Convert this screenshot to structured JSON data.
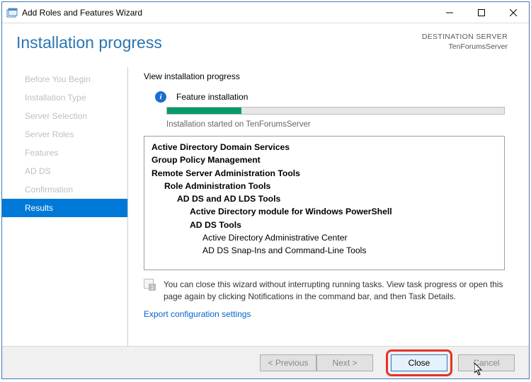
{
  "window": {
    "title": "Add Roles and Features Wizard"
  },
  "header": {
    "page_title": "Installation progress",
    "destination_label": "DESTINATION SERVER",
    "destination_value": "TenForumsServer"
  },
  "sidebar": {
    "items": [
      {
        "label": "Before You Begin"
      },
      {
        "label": "Installation Type"
      },
      {
        "label": "Server Selection"
      },
      {
        "label": "Server Roles"
      },
      {
        "label": "Features"
      },
      {
        "label": "AD DS"
      },
      {
        "label": "Confirmation"
      },
      {
        "label": "Results"
      }
    ],
    "active_index": 7
  },
  "main": {
    "heading": "View installation progress",
    "info_text": "Feature installation",
    "progress_percent": 22,
    "progress_status": "Installation started on TenForumsServer",
    "features": [
      {
        "text": "Active Directory Domain Services",
        "indent": 0,
        "bold": true
      },
      {
        "text": "Group Policy Management",
        "indent": 0,
        "bold": true
      },
      {
        "text": "Remote Server Administration Tools",
        "indent": 0,
        "bold": true
      },
      {
        "text": "Role Administration Tools",
        "indent": 1,
        "bold": true
      },
      {
        "text": "AD DS and AD LDS Tools",
        "indent": 2,
        "bold": true
      },
      {
        "text": "Active Directory module for Windows PowerShell",
        "indent": 3,
        "bold": true
      },
      {
        "text": "AD DS Tools",
        "indent": 3,
        "bold": true
      },
      {
        "text": "Active Directory Administrative Center",
        "indent": 4,
        "bold": false
      },
      {
        "text": "AD DS Snap-Ins and Command-Line Tools",
        "indent": 4,
        "bold": false
      }
    ],
    "note": "You can close this wizard without interrupting running tasks. View task progress or open this page again by clicking Notifications in the command bar, and then Task Details.",
    "export_link": "Export configuration settings"
  },
  "footer": {
    "previous": "< Previous",
    "next": "Next >",
    "close": "Close",
    "cancel": "Cancel"
  }
}
